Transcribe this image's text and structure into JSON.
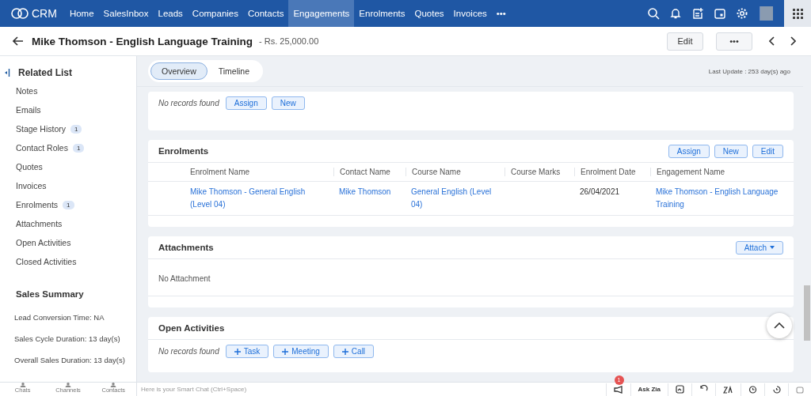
{
  "nav": {
    "logo": "CRM",
    "items": [
      {
        "label": "Home",
        "selected": false
      },
      {
        "label": "SalesInbox",
        "selected": false
      },
      {
        "label": "Leads",
        "selected": false
      },
      {
        "label": "Companies",
        "selected": false
      },
      {
        "label": "Contacts",
        "selected": false
      },
      {
        "label": "Engagements",
        "selected": true
      },
      {
        "label": "Enrolments",
        "selected": false
      },
      {
        "label": "Quotes",
        "selected": false
      },
      {
        "label": "Invoices",
        "selected": false
      }
    ],
    "more": "•••"
  },
  "record": {
    "title": "Mike Thomson - English Language Training",
    "amount": "- Rs. 25,000.00",
    "buttons": [
      "Edit",
      "•••"
    ]
  },
  "sidebar": {
    "title": "Related List",
    "items": [
      {
        "label": "Notes"
      },
      {
        "label": "Emails"
      },
      {
        "label": "Stage History",
        "count": "1"
      },
      {
        "label": "Contact Roles",
        "count": "1"
      },
      {
        "label": "Quotes"
      },
      {
        "label": "Invoices"
      },
      {
        "label": "Enrolments",
        "count": "1"
      },
      {
        "label": "Attachments"
      },
      {
        "label": "Open Activities"
      },
      {
        "label": "Closed Activities"
      }
    ],
    "summary_title": "Sales Summary",
    "summary": [
      "Lead Conversion Time: NA",
      "Sales Cycle Duration: 13 day(s)",
      "Overall Sales Duration: 13 day(s)"
    ]
  },
  "view_tabs": [
    {
      "label": "Overview",
      "selected": true
    },
    {
      "label": "Timeline",
      "selected": false
    }
  ],
  "last_update": "Last Update : 253 day(s) ago",
  "top_card": {
    "empty": "No records found",
    "buttons": [
      "Assign",
      "New"
    ]
  },
  "enrolments": {
    "title": "Enrolments",
    "buttons": [
      "Assign",
      "New",
      "Edit"
    ],
    "columns": [
      "Enrolment Name",
      "Contact Name",
      "Course Name",
      "Course Marks",
      "Enrolment Date",
      "Engagement Name"
    ],
    "rows": [
      {
        "cells": [
          {
            "text": "Mike Thomson - General English (Level 04)",
            "link": true
          },
          {
            "text": "Mike Thomson",
            "link": true
          },
          {
            "text": "General English (Level 04)",
            "link": true
          },
          null,
          {
            "text": "26/04/2021",
            "link": false
          },
          {
            "text": "Mike Thomson - English Language Training",
            "link": true
          }
        ]
      }
    ]
  },
  "attachments": {
    "title": "Attachments",
    "button": "Attach",
    "empty": "No Attachment"
  },
  "open_activities": {
    "title": "Open Activities",
    "empty": "No records found",
    "buttons": [
      "Task",
      "Meeting",
      "Call"
    ]
  },
  "bottom_bar": {
    "tabs": [
      "Chats",
      "Channels",
      "Contacts"
    ],
    "chat_placeholder": "Here is your Smart Chat (Ctrl+Space)",
    "notification_count": "1",
    "ask_zia": "Ask Zia"
  }
}
